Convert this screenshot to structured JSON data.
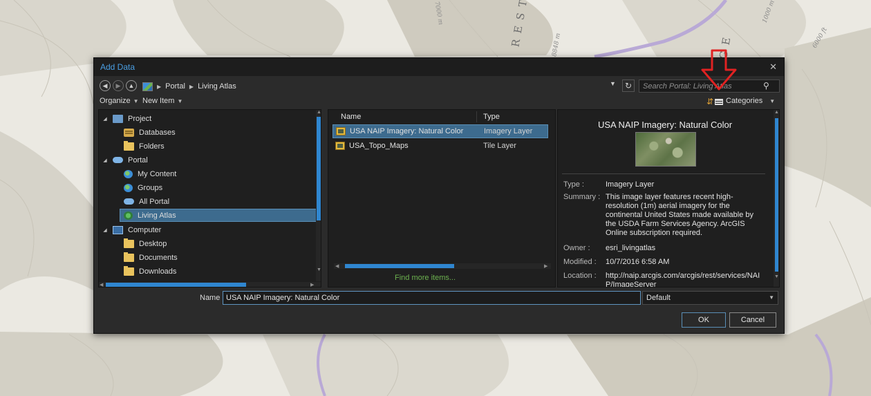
{
  "map": {
    "labels": [
      "7000 m",
      "R E S T",
      "8848 m",
      "G E",
      "1000 m",
      "6000 ft"
    ]
  },
  "dialog": {
    "title": "Add Data",
    "address": {
      "crumbs": [
        "Portal",
        "Living Atlas"
      ],
      "search_placeholder": "Search Portal: Living Atlas"
    },
    "toolbar": {
      "organize": "Organize",
      "new_item": "New Item",
      "categories": "Categories"
    },
    "tree": [
      {
        "label": "Project",
        "icon": "project-icon",
        "level": 0,
        "expanded": true
      },
      {
        "label": "Databases",
        "icon": "database-icon",
        "level": 1
      },
      {
        "label": "Folders",
        "icon": "folder-icon",
        "level": 1
      },
      {
        "label": "Portal",
        "icon": "cloud-icon",
        "level": 0,
        "expanded": true
      },
      {
        "label": "My Content",
        "icon": "globe-icon",
        "level": 1
      },
      {
        "label": "Groups",
        "icon": "groups-icon",
        "level": 1
      },
      {
        "label": "All Portal",
        "icon": "cloud-icon",
        "level": 1
      },
      {
        "label": "Living Atlas",
        "icon": "living-atlas-icon",
        "level": 1,
        "selected": true
      },
      {
        "label": "Computer",
        "icon": "computer-icon",
        "level": 0,
        "expanded": true
      },
      {
        "label": "Desktop",
        "icon": "folder-icon",
        "level": 1
      },
      {
        "label": "Documents",
        "icon": "folder-icon",
        "level": 1
      },
      {
        "label": "Downloads",
        "icon": "folder-icon",
        "level": 1
      }
    ],
    "list": {
      "columns": [
        "Name",
        "Type"
      ],
      "rows": [
        {
          "name": "USA NAIP Imagery: Natural Color",
          "type": "Imagery Layer",
          "selected": true
        },
        {
          "name": "USA_Topo_Maps",
          "type": "Tile Layer"
        }
      ],
      "find_more": "Find more items..."
    },
    "details": {
      "title": "USA NAIP Imagery: Natural Color",
      "fields": [
        {
          "key": "Type :",
          "value": "Imagery Layer"
        },
        {
          "key": "Summary :",
          "value": "This image layer features recent high-resolution (1m) aerial imagery for the continental United States made available by the USDA Farm Services Agency. ArcGIS Online subscription required."
        },
        {
          "key": "Owner :",
          "value": "esri_livingatlas"
        },
        {
          "key": "Modified :",
          "value": "10/7/2016 6:58 AM"
        },
        {
          "key": "Location :",
          "value": "http://naip.arcgis.com/arcgis/rest/services/NAIP/ImageServer"
        }
      ]
    },
    "name_label": "Name",
    "name_value": "USA NAIP Imagery: Natural Color",
    "filter_value": "Default",
    "ok_label": "OK",
    "cancel_label": "Cancel"
  },
  "colors": {
    "accent": "#2f86d0",
    "selection": "#3d6b8e",
    "annotation": "#e02222",
    "link": "#6db34f"
  }
}
